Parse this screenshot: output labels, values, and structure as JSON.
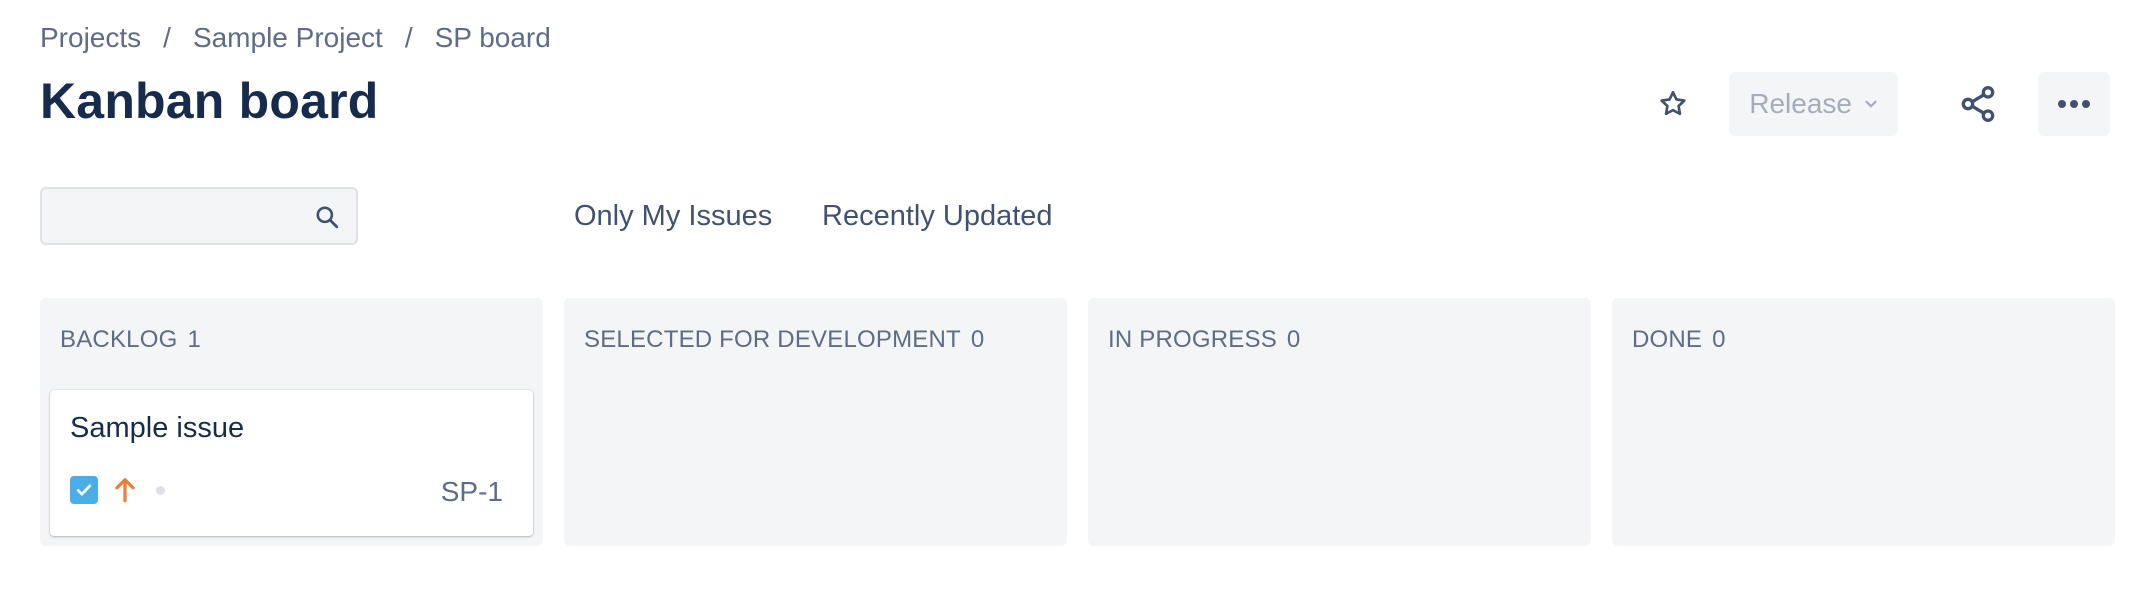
{
  "breadcrumb": {
    "items": [
      "Projects",
      "Sample Project",
      "SP board"
    ],
    "separator": "/"
  },
  "page_title": "Kanban board",
  "header_actions": {
    "star_icon": "star-icon",
    "release_label": "Release",
    "release_chevron_icon": "chevron-down-icon",
    "share_icon": "share-icon",
    "more_icon": "more-horizontal-icon"
  },
  "search": {
    "value": "",
    "placeholder": "",
    "icon": "search-icon"
  },
  "quick_filters": [
    "Only My Issues",
    "Recently Updated"
  ],
  "columns": [
    {
      "title": "BACKLOG",
      "count": "1",
      "cards": [
        {
          "title": "Sample issue",
          "type_icon": "task-checkbox-icon",
          "priority_icon": "priority-high-arrow-icon",
          "status_icon": "status-dot-icon",
          "key": "SP-1"
        }
      ]
    },
    {
      "title": "SELECTED FOR DEVELOPMENT",
      "count": "0",
      "cards": []
    },
    {
      "title": "IN PROGRESS",
      "count": "0",
      "cards": []
    },
    {
      "title": "DONE",
      "count": "0",
      "cards": []
    }
  ],
  "colors": {
    "text_primary": "#172b4d",
    "text_secondary": "#5e6c84",
    "column_bg": "#f4f5f7",
    "task_icon": "#4bade8",
    "priority_high": "#e97f33",
    "disabled_text": "#a5adba"
  }
}
